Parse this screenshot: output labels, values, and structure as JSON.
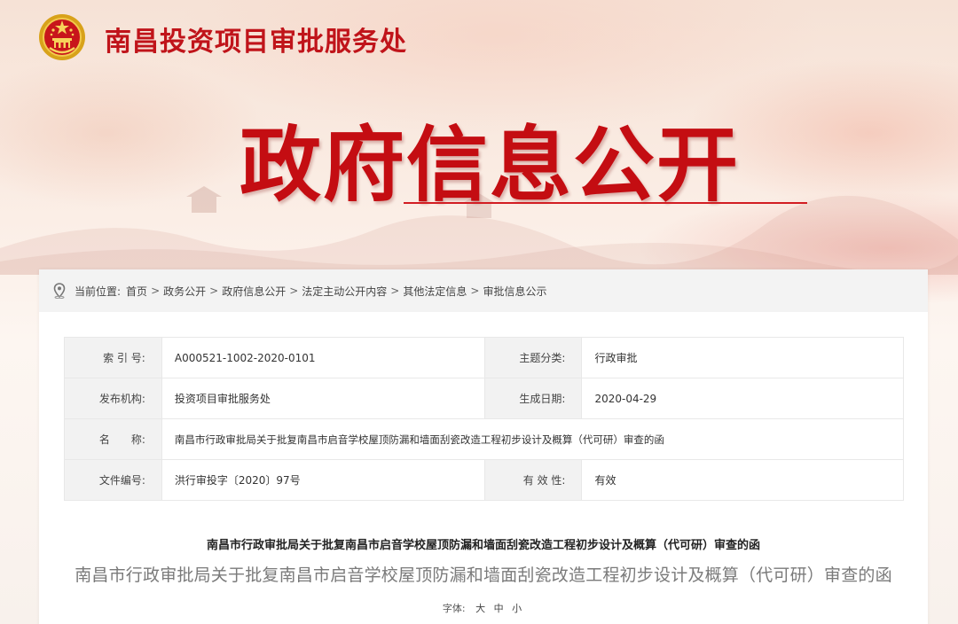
{
  "header": {
    "org_name": "南昌投资项目审批服务处",
    "banner_title": "政府信息公开"
  },
  "breadcrumb": {
    "prefix": "当前位置:",
    "items": [
      "首页",
      "政务公开",
      "政府信息公开",
      "法定主动公开内容",
      "其他法定信息",
      "审批信息公示"
    ],
    "separator": ">"
  },
  "info": {
    "index_label": "索 引 号:",
    "index_value": "A000521-1002-2020-0101",
    "category_label": "主题分类:",
    "category_value": "行政审批",
    "publisher_label": "发布机构:",
    "publisher_value": "投资项目审批服务处",
    "date_label": "生成日期:",
    "date_value": "2020-04-29",
    "name_label": "名　　称:",
    "name_value": "南昌市行政审批局关于批复南昌市启音学校屋顶防漏和墙面刮瓷改造工程初步设计及概算（代可研）审查的函",
    "docno_label": "文件编号:",
    "docno_value": "洪行审投字〔2020〕97号",
    "validity_label": "有 效 性:",
    "validity_value": "有效"
  },
  "document": {
    "title_bold": "南昌市行政审批局关于批复南昌市启音学校屋顶防漏和墙面刮瓷改造工程初步设计及概算（代可研）审查的函",
    "title": "南昌市行政审批局关于批复南昌市启音学校屋顶防漏和墙面刮瓷改造工程初步设计及概算（代可研）审查的函"
  },
  "font_size": {
    "label": "字体:",
    "large": "大",
    "medium": "中",
    "small": "小"
  },
  "colors": {
    "brand_red": "#c40d12",
    "panel_bg": "#ffffff",
    "label_bg": "#f2f2f2"
  }
}
